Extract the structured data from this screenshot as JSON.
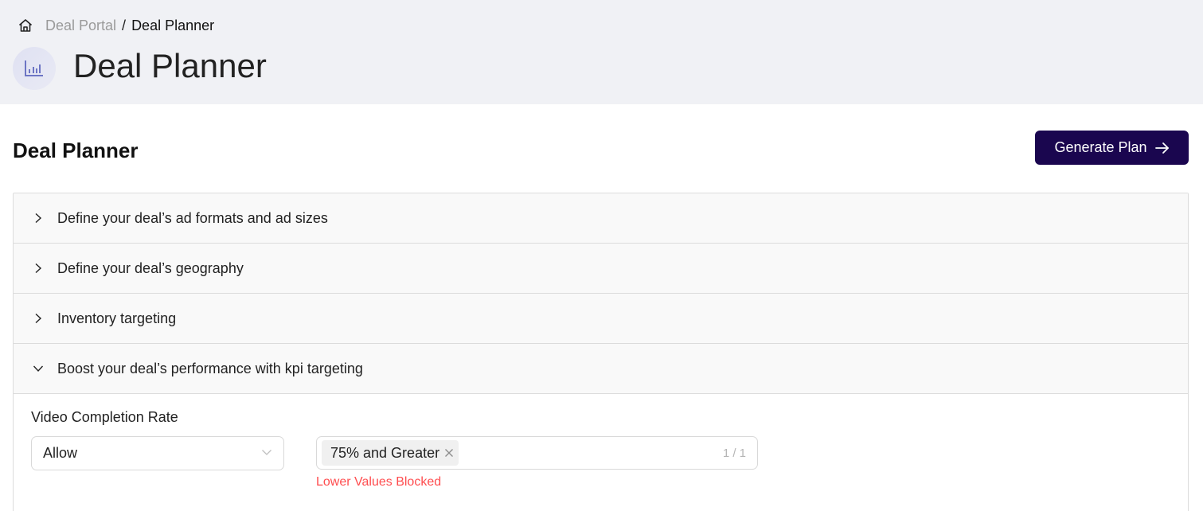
{
  "breadcrumb": {
    "home_icon": "home-icon",
    "items": [
      "Deal Portal",
      "Deal Planner"
    ],
    "separator": "/"
  },
  "header": {
    "icon": "bar-chart-icon",
    "title": "Deal Planner"
  },
  "main": {
    "section_title": "Deal Planner",
    "generate_button": {
      "label": "Generate Plan",
      "icon": "arrow-right-icon"
    },
    "colors": {
      "primary": "#1a064f",
      "error": "#ff4d4f",
      "header_bg": "#f0f1f5"
    },
    "panels": [
      {
        "title": "Define your deal’s ad formats and ad sizes",
        "expanded": false
      },
      {
        "title": "Define your deal’s geography",
        "expanded": false
      },
      {
        "title": "Inventory targeting",
        "expanded": false
      },
      {
        "title": "Boost your deal’s performance with kpi targeting",
        "expanded": true
      }
    ],
    "kpi": {
      "label": "Video Completion Rate",
      "mode_select": {
        "value": "Allow",
        "icon": "chevron-down-icon"
      },
      "values_select": {
        "tags": [
          "75% and Greater"
        ],
        "count": "1 / 1"
      },
      "hint": "Lower Values Blocked"
    }
  }
}
